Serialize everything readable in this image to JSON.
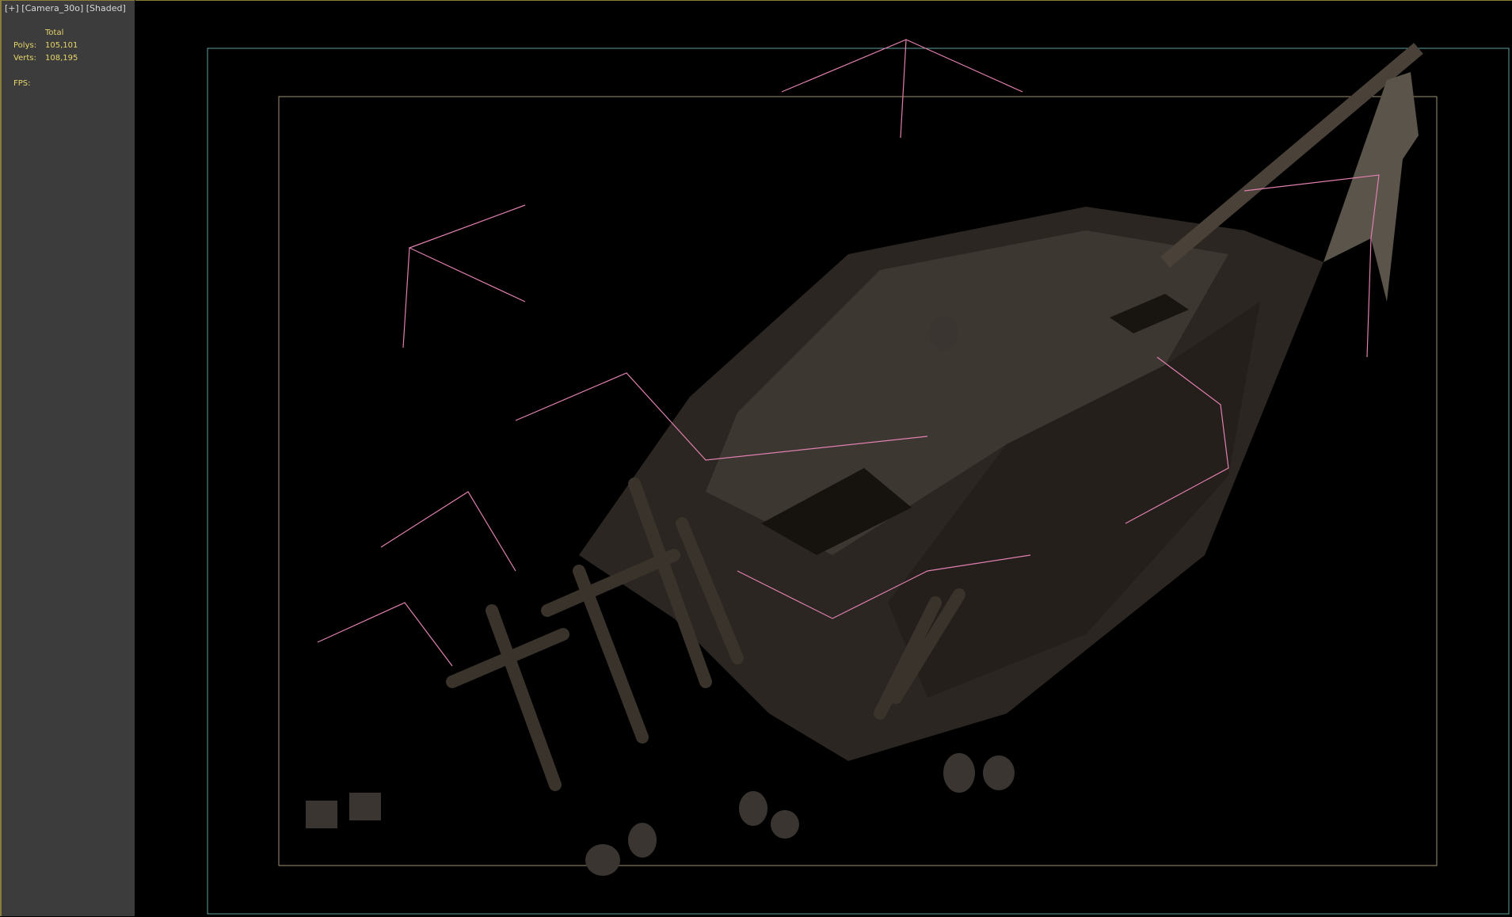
{
  "viewport": {
    "label": "[+] [Camera_30o] [Shaded]",
    "stats": {
      "header": "Total",
      "polys_label": "Polys:",
      "polys_value": "105,101",
      "verts_label": "Verts:",
      "verts_value": "108,195",
      "fps_label": "FPS:"
    }
  },
  "colors": {
    "safe_frame_outer": "#5fa0a0",
    "safe_frame_inner": "#a09070",
    "gizmo": "#e080b0",
    "stat_text": "#e6d66a"
  }
}
